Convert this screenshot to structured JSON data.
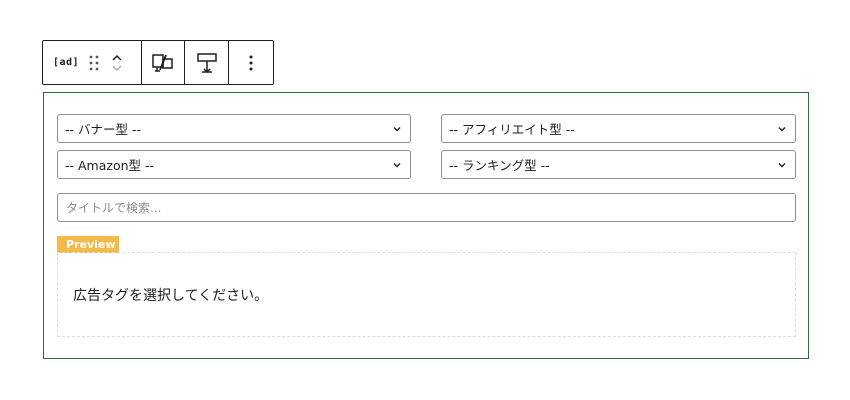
{
  "toolbar": {
    "block_icon_label": "[ad]",
    "icons": [
      "block-type-icon",
      "drag-handle-icon",
      "move-up-icon",
      "move-down-icon",
      "device-toggle-icon",
      "spacing-icon",
      "more-options-icon"
    ]
  },
  "selects": {
    "banner": "-- バナー型 --",
    "affiliate": "-- アフィリエイト型 --",
    "amazon": "-- Amazon型 --",
    "ranking": "-- ランキング型 --"
  },
  "search": {
    "placeholder": "タイトルで検索..."
  },
  "preview": {
    "badge": "Preview",
    "message": "広告タグを選択してください。"
  },
  "colors": {
    "block_border": "#2f6e3a",
    "badge_bg": "#f4b94a",
    "field_border": "#8c8f94"
  }
}
